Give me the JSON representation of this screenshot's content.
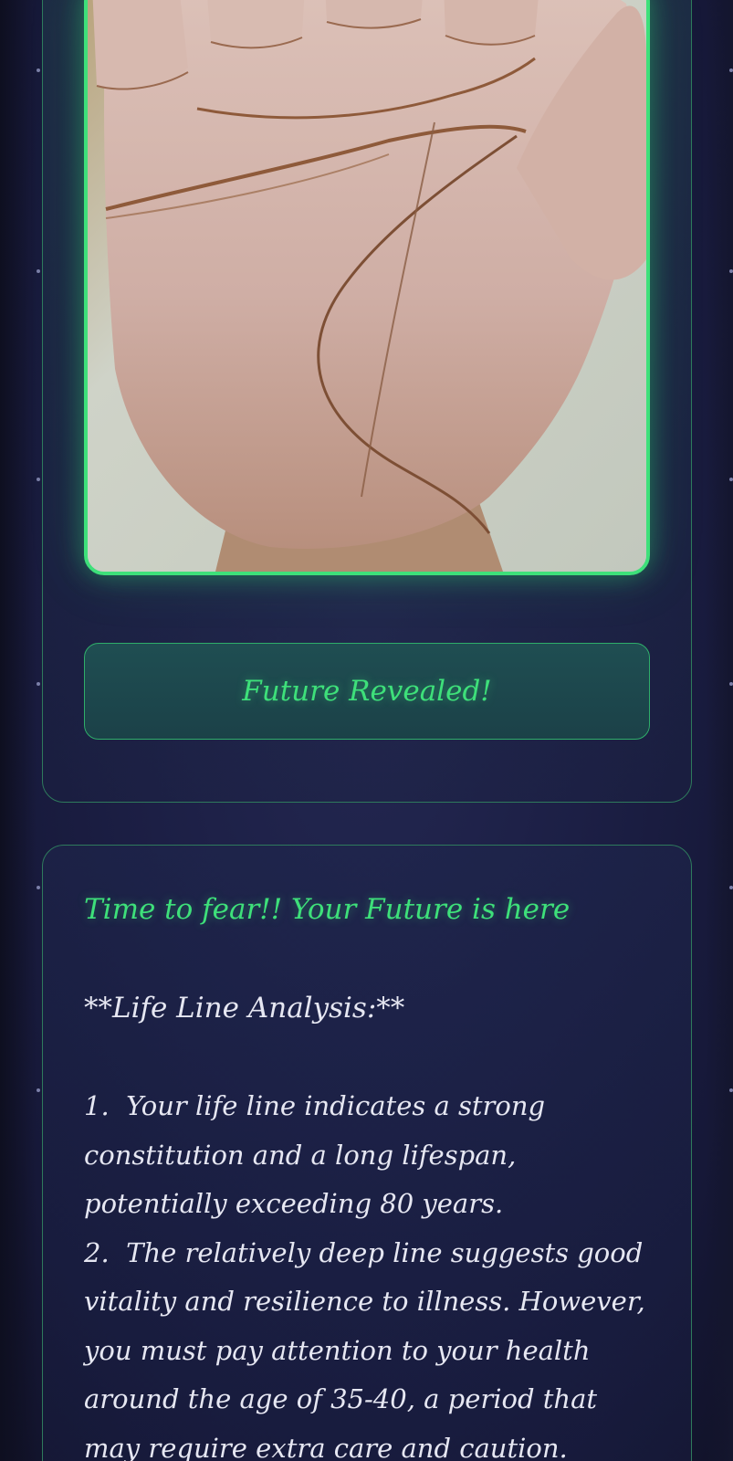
{
  "palm_scan": {
    "image_alt": "Photo of an open palm"
  },
  "action": {
    "button_label": "Future Revealed!"
  },
  "result": {
    "heading": "Time to fear!! Your Future is here",
    "analysis_title": "**Life Line Analysis:**",
    "items": [
      {
        "number": "1.",
        "text": "Your life line indicates a strong constitution and a long lifespan, potentially exceeding 80 years."
      },
      {
        "number": "2.",
        "text": "The relatively deep line suggests good vitality and resilience to illness. However, you must pay attention to your health around the age of 35-40, a period that may require extra care and caution."
      }
    ]
  },
  "colors": {
    "accent_green": "#3ee07a",
    "card_border": "#2e7a5c",
    "background": "#1c1f45",
    "text": "#e6e7f2"
  }
}
